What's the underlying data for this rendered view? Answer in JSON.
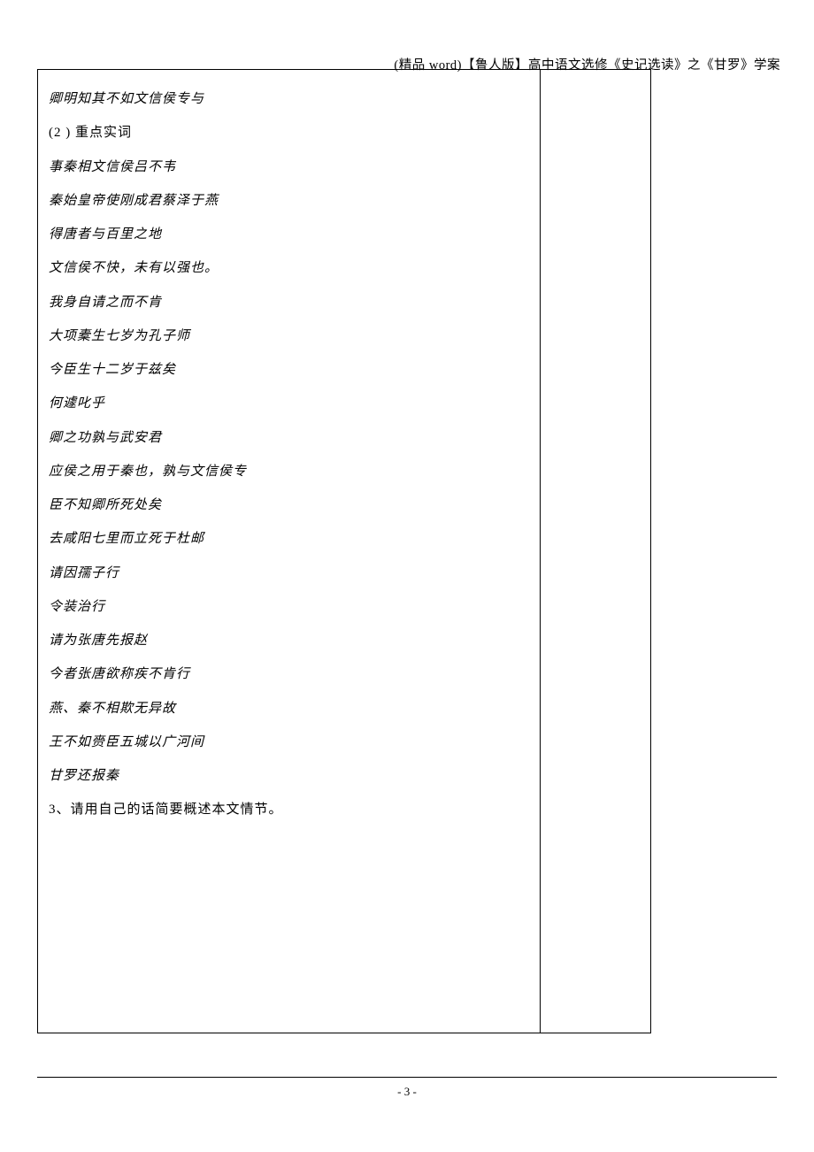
{
  "header": {
    "title": "(精品 word)【鲁人版】高中语文选修《史记选读》之《甘罗》学案"
  },
  "content": {
    "lines": [
      "卿明知其不如文信侯专与",
      "(2  ) 重点实词",
      "事秦相文信侯吕不韦",
      "秦始皇帝使刚成君蔡泽于燕",
      "得唐者与百里之地",
      "文信侯不快，未有以强也。",
      "我身自请之而不肯",
      "大项橐生七岁为孔子师",
      "今臣生十二岁于兹矣",
      "何遽叱乎",
      "卿之功孰与武安君",
      "应侯之用于秦也，孰与文信侯专",
      "臣不知卿所死处矣",
      "去咸阳七里而立死于杜邮",
      "请因孺子行",
      "令装治行",
      "请为张唐先报赵",
      "今者张唐欲称疾不肯行",
      "燕、秦不相欺无异故",
      "王不如赍臣五城以广河间",
      "甘罗还报秦",
      "3、请用自己的话简要概述本文情节。"
    ]
  },
  "footer": {
    "page_number": "- 3 -"
  }
}
